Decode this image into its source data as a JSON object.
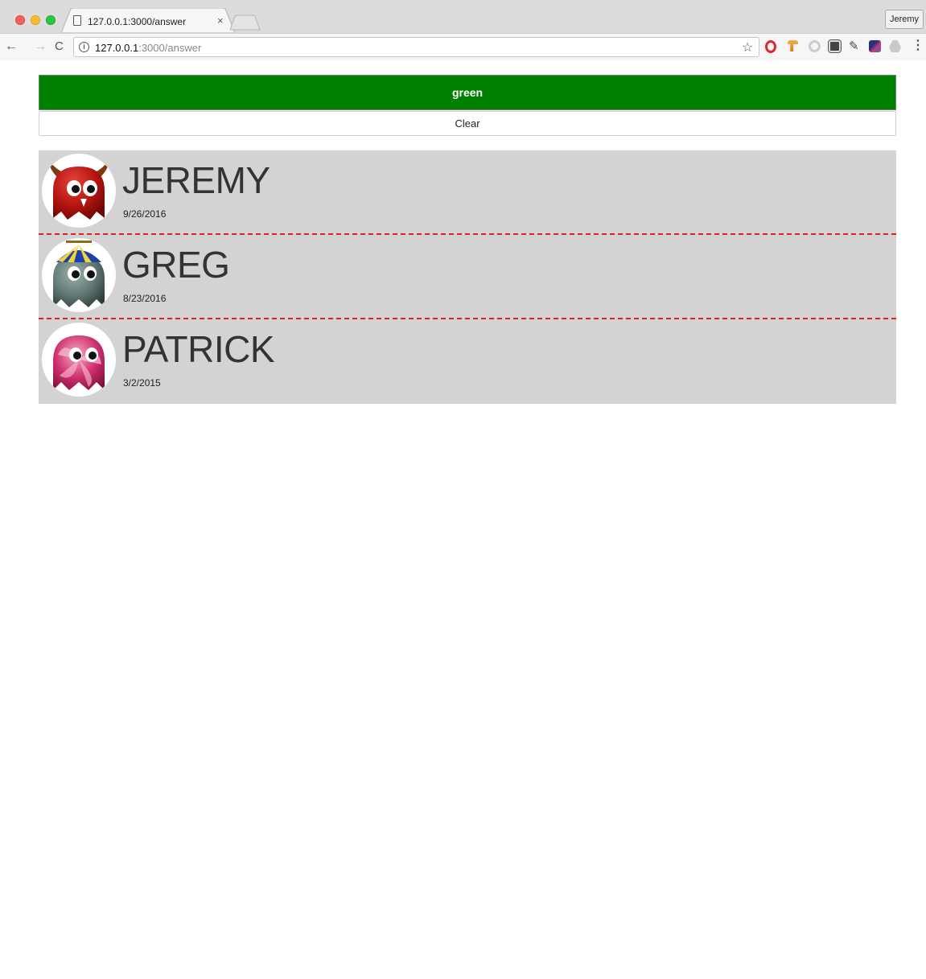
{
  "browser": {
    "tab_title": "127.0.0.1:3000/answer",
    "tab_close": "×",
    "profile_name": "Jeremy",
    "url_host": "127.0.0.1",
    "url_path": ":3000/answer",
    "info_glyph": "i",
    "star_glyph": "☆",
    "menu_glyph": "⋮",
    "back_glyph": "←",
    "forward_glyph": "→",
    "reload_glyph": "C"
  },
  "page": {
    "color_label": "green",
    "color_value": "#008000",
    "clear_label": "Clear"
  },
  "people": [
    {
      "name": "JEREMY",
      "date": "9/26/2016",
      "avatar_icon": "red-devil-monster-icon"
    },
    {
      "name": "GREG",
      "date": "8/23/2016",
      "avatar_icon": "propeller-hat-ghost-icon"
    },
    {
      "name": "PATRICK",
      "date": "3/2/2015",
      "avatar_icon": "pink-candy-ghost-icon"
    }
  ]
}
